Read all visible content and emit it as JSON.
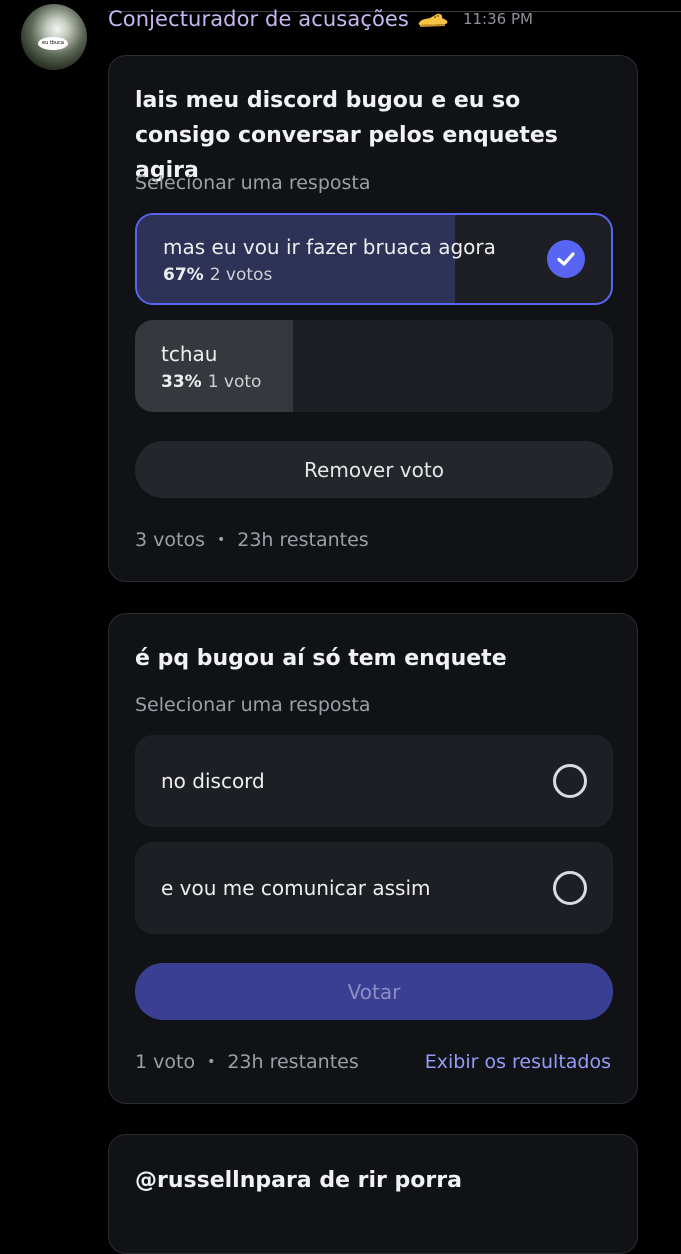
{
  "message": {
    "author": "Conjecturador de acusações",
    "badge_icon": "shoe-emoji",
    "timestamp": "11:36 PM",
    "avatar_text": "eu tbuca"
  },
  "polls": [
    {
      "question": "lais meu discord bugou e eu so consigo conversar pelos enquetes agira",
      "prompt": "Selecionar uma resposta",
      "options": [
        {
          "label": "mas eu vou ir fazer bruaca agora",
          "percent": "67%",
          "votes": "2 votos",
          "selected": true
        },
        {
          "label": "tchau",
          "percent": "33%",
          "votes": "1 voto",
          "selected": false
        }
      ],
      "action_label": "Remover voto",
      "total_votes": "3 votos",
      "time_left": "23h restantes"
    },
    {
      "question": "é pq bugou aí só tem enquete",
      "prompt": "Selecionar uma resposta",
      "options": [
        {
          "label": "no discord"
        },
        {
          "label": "e vou me comunicar assim"
        }
      ],
      "action_label": "Votar",
      "total_votes": "1 voto",
      "time_left": "23h restantes",
      "results_link": "Exibir os resultados"
    },
    {
      "question": "@russellnpara de rir porra"
    }
  ],
  "colors": {
    "accent": "#5865f2",
    "link": "#949cf7",
    "username": "#c7b8f2",
    "card": "#111216",
    "fill_selected": "#2f3257",
    "fill_other": "#36383e"
  }
}
